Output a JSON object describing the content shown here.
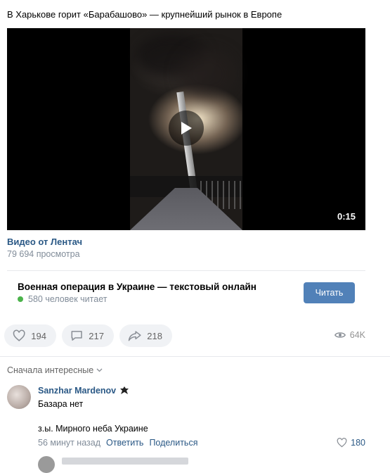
{
  "post": {
    "text": "В Харькове горит «Барабашово» — крупнейший рынок в Европе"
  },
  "video": {
    "duration": "0:15",
    "title": "Видео от Лентач",
    "views": "79 694 просмотра"
  },
  "promo": {
    "title": "Военная операция в Украине — текстовый онлайн",
    "readers": "580 человек читает",
    "button_label": "Читать",
    "button_color": "#5181b8",
    "online_dot_color": "#4bb34b"
  },
  "actions": {
    "likes": "194",
    "comments": "217",
    "shares": "218",
    "views": "64K"
  },
  "comments": {
    "sort_label": "Сначала интересные",
    "items": [
      {
        "author": "Sanzhar Mardenov",
        "line1": "Базара нет",
        "line2": "з.ы. Мирного неба Украине",
        "time": "56 минут назад",
        "reply_label": "Ответить",
        "share_label": "Поделиться",
        "likes": "180"
      }
    ]
  },
  "colors": {
    "link": "#2a5885",
    "muted": "#818c99"
  },
  "icons": [
    "play-icon",
    "heart-icon",
    "comment-icon",
    "share-icon",
    "eye-icon",
    "chevron-down-icon",
    "verified-icon"
  ]
}
